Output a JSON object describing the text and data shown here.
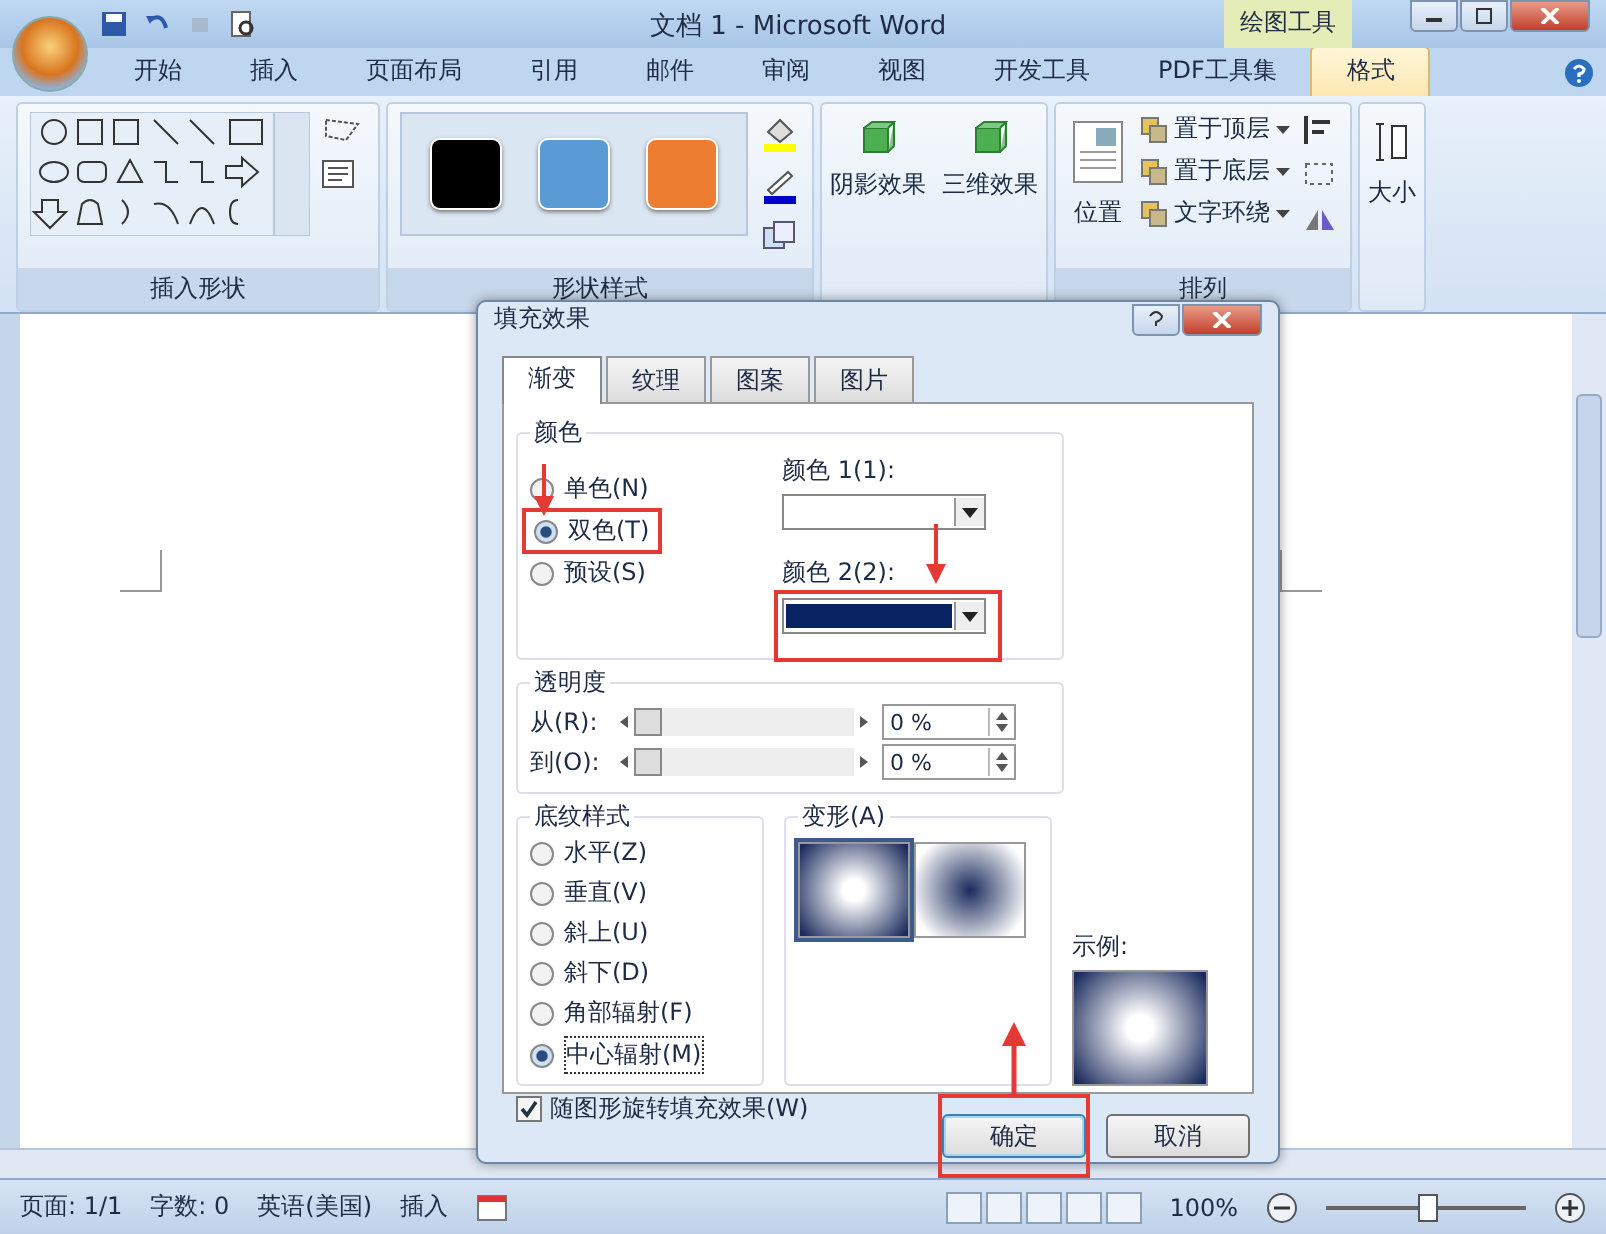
{
  "window": {
    "title": "文档 1 - Microsoft Word",
    "context_tab": "绘图工具"
  },
  "tabs": [
    {
      "label": "开始",
      "selected": false
    },
    {
      "label": "插入",
      "selected": false
    },
    {
      "label": "页面布局",
      "selected": false
    },
    {
      "label": "引用",
      "selected": false
    },
    {
      "label": "邮件",
      "selected": false
    },
    {
      "label": "审阅",
      "selected": false
    },
    {
      "label": "视图",
      "selected": false
    },
    {
      "label": "开发工具",
      "selected": false
    },
    {
      "label": "PDF工具集",
      "selected": false
    },
    {
      "label": "格式",
      "selected": true
    }
  ],
  "ribbon": [
    {
      "kind": "shapes",
      "label": "插入形状"
    },
    {
      "kind": "styles",
      "label": "形状样式",
      "swatches": [
        {
          "color": "#000000"
        },
        {
          "color": "#5b9bd5"
        },
        {
          "color": "#ed7d31"
        }
      ]
    },
    {
      "kind": "effects",
      "buttons": [
        "阴影效果",
        "三维效果"
      ]
    },
    {
      "kind": "arrange",
      "label": "排列",
      "big": "位置",
      "items": [
        "置于顶层",
        "置于底层",
        "文字环绕"
      ]
    },
    {
      "kind": "size",
      "big": "大小"
    }
  ],
  "dialog": {
    "title": "填充效果",
    "tabs": [
      {
        "label": "渐变",
        "selected": true
      },
      {
        "label": "纹理",
        "selected": false
      },
      {
        "label": "图案",
        "selected": false
      },
      {
        "label": "图片",
        "selected": false
      }
    ],
    "colors": {
      "label": "颜色",
      "options": [
        {
          "label": "单色(N)",
          "selected": false
        },
        {
          "label": "双色(T)",
          "selected": true
        },
        {
          "label": "预设(S)",
          "selected": false
        }
      ],
      "color1_label": "颜色 1(1):",
      "color2_label": "颜色 2(2):"
    },
    "transparency": {
      "label": "透明度",
      "rows": [
        {
          "label": "从(R):",
          "level": 0,
          "value": "0 %"
        },
        {
          "label": "到(O):",
          "level": 0,
          "value": "0 %"
        }
      ]
    },
    "shading": {
      "label": "底纹样式",
      "options": [
        {
          "label": "水平(Z)",
          "selected": false
        },
        {
          "label": "垂直(V)",
          "selected": false
        },
        {
          "label": "斜上(U)",
          "selected": false
        },
        {
          "label": "斜下(D)",
          "selected": false
        },
        {
          "label": "角部辐射(F)",
          "selected": false
        },
        {
          "label": "中心辐射(M)",
          "selected": true
        }
      ]
    },
    "variants": {
      "label": "变形(A)",
      "items": [
        {
          "kind": "dark-edge",
          "selected": true
        },
        {
          "kind": "dark-center",
          "selected": false
        }
      ]
    },
    "sample_label": "示例:",
    "rotate": {
      "label": "随图形旋转填充效果(W)",
      "checked": true
    },
    "buttons": [
      {
        "label": "确定",
        "default": true
      },
      {
        "label": "取消",
        "default": false
      }
    ]
  },
  "status_bar": {
    "items": [
      "页面: 1/1",
      "字数: 0",
      "英语(美国)",
      "插入"
    ],
    "zoom": "100%",
    "zoom_level": {
      "level": 0.5
    }
  }
}
